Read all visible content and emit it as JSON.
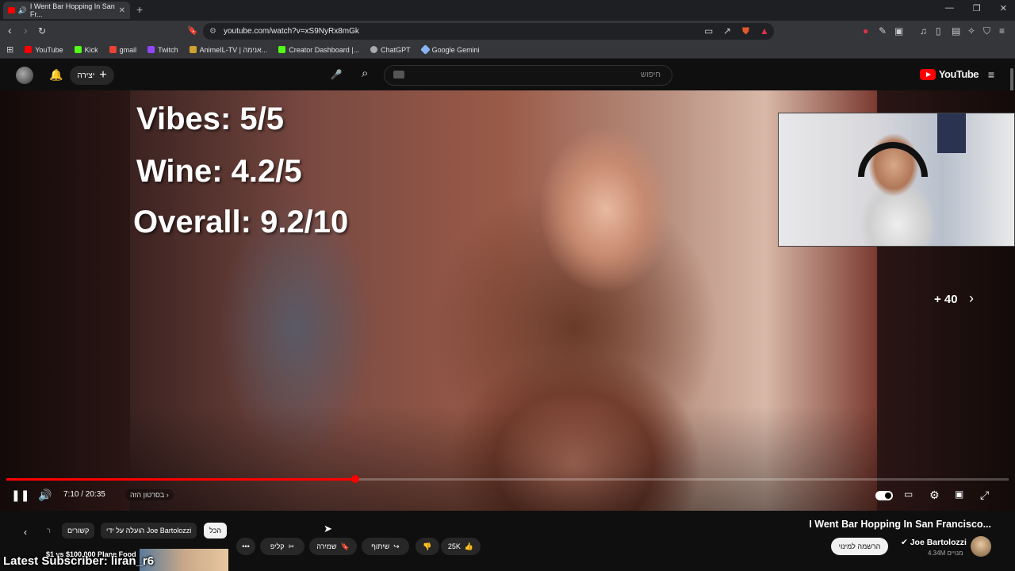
{
  "browser": {
    "tab_title": "I Went Bar Hopping In San Fr...",
    "url": "youtube.com/watch?v=xS9NyRx8mGk",
    "bookmarks": [
      {
        "label": "YouTube",
        "color": "#ff0000"
      },
      {
        "label": "Kick",
        "color": "#53fc18"
      },
      {
        "label": "gmail",
        "color": "#ea4335"
      },
      {
        "label": "Twitch",
        "color": "#9146ff"
      },
      {
        "label": "AnimeIL-TV | אנימה...",
        "color": "#d0a030"
      },
      {
        "label": "Creator Dashboard |...",
        "color": "#53fc18"
      },
      {
        "label": "ChatGPT",
        "color": "#aaaaaa"
      },
      {
        "label": "Google Gemini",
        "color": "#8ab4f8"
      }
    ]
  },
  "header": {
    "create_label": "יצירה",
    "search_placeholder": "חיפוש",
    "logo_text": "YouTube"
  },
  "video": {
    "overlay_lines": [
      "Vibes: 5/5",
      "Wine: 4.2/5",
      "Overall: 9.2/10"
    ],
    "more_count": "+ 40",
    "time_display": "7:10 / 20:35",
    "chapter_label": "בסרטון הזה",
    "progress_fraction": 0.348
  },
  "below": {
    "title": "I Went Bar Hopping In San Francisco...",
    "channel_name": "Joe Bartolozzi",
    "channel_subs": "4.34M מנויים",
    "subscribe_label": "הרשמה למינוי",
    "like_count": "25K",
    "share_label": "שיתוף",
    "save_label": "שמירה",
    "clip_label": "קליפ",
    "chips": [
      "הכל",
      "הועלה על ידי Joe Bartolozzi",
      "קשורים",
      "ר"
    ],
    "rec_title": "$1 vs $100,000 Plane Food",
    "overlay_subscriber": "Latest Subscriber: liran_r6"
  }
}
